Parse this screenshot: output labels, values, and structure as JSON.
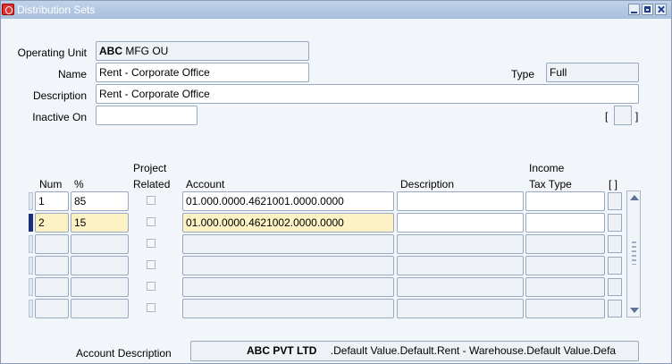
{
  "window": {
    "title": "Distribution Sets"
  },
  "header": {
    "operating_unit_label": "Operating Unit",
    "operating_unit_bold": "ABC",
    "operating_unit_value": "MFG OU",
    "name_label": "Name",
    "name_value": "Rent - Corporate Office",
    "type_label": "Type",
    "type_value": "Full",
    "description_label": "Description",
    "description_value": "Rent - Corporate Office",
    "inactive_on_label": "Inactive On",
    "inactive_on_value": "",
    "dff_open": "[",
    "dff_close": "]"
  },
  "table": {
    "columns": {
      "num": "Num",
      "pct": "%",
      "project_line1": "Project",
      "project_line2": "Related",
      "account": "Account",
      "description": "Description",
      "income_line1": "Income",
      "income_line2": "Tax Type",
      "dff": "[ ]"
    },
    "rows": [
      {
        "num": "1",
        "pct": "85",
        "account": "01.000.0000.4621001.0000.0000",
        "description": "",
        "income_tax_type": ""
      },
      {
        "num": "2",
        "pct": "15",
        "account": "01.000.0000.4621002.0000.0000",
        "description": "",
        "income_tax_type": ""
      },
      {
        "num": "",
        "pct": "",
        "account": "",
        "description": "",
        "income_tax_type": ""
      },
      {
        "num": "",
        "pct": "",
        "account": "",
        "description": "",
        "income_tax_type": ""
      },
      {
        "num": "",
        "pct": "",
        "account": "",
        "description": "",
        "income_tax_type": ""
      },
      {
        "num": "",
        "pct": "",
        "account": "",
        "description": "",
        "income_tax_type": ""
      }
    ]
  },
  "footer": {
    "account_description_label": "Account Description",
    "account_description_bold": "ABC PVT LTD",
    "account_description_value": ".Default Value.Default.Rent - Warehouse.Default Value.Defa"
  }
}
